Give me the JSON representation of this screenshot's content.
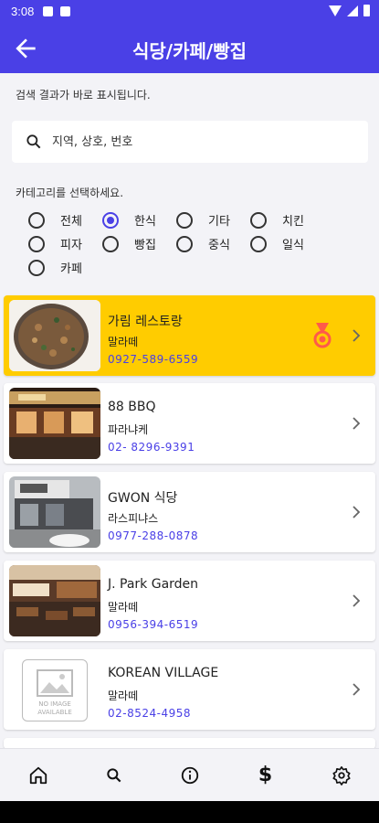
{
  "status_bar": {
    "time": "3:08"
  },
  "header": {
    "title": "식당/카페/빵집"
  },
  "hint": "검색 결과가 바로 표시됩니다.",
  "search": {
    "placeholder": "지역, 상호, 번호"
  },
  "category": {
    "label": "카테고리를 선택하세요.",
    "options": [
      "전체",
      "한식",
      "기타",
      "치킨",
      "피자",
      "빵집",
      "중식",
      "일식",
      "카페"
    ],
    "selected": "한식"
  },
  "restaurants": [
    {
      "name": "가림 레스토랑",
      "region": "말라떼",
      "phone": "0927-589-6559",
      "highlighted": true,
      "badge": "medal-icon"
    },
    {
      "name": "88 BBQ",
      "region": "파라냐케",
      "phone": "02- 8296-9391"
    },
    {
      "name": "GWON 식당",
      "region": "라스피냐스",
      "phone": "0977-288-0878"
    },
    {
      "name": "J. Park Garden",
      "region": "말라떼",
      "phone": "0956-394-6519"
    },
    {
      "name": "KOREAN VILLAGE",
      "region": "말라떼",
      "phone": "02-8524-4958",
      "no_image_text": "NO IMAGE AVAILABLE"
    }
  ],
  "bottom_nav": {
    "items": [
      "home-icon",
      "search-icon",
      "info-icon",
      "dollar-icon",
      "settings-icon"
    ],
    "dollar_glyph": "$"
  },
  "colors": {
    "primary": "#4a40e6",
    "highlight": "#ffcc00",
    "medal": "#ff5a4a"
  }
}
